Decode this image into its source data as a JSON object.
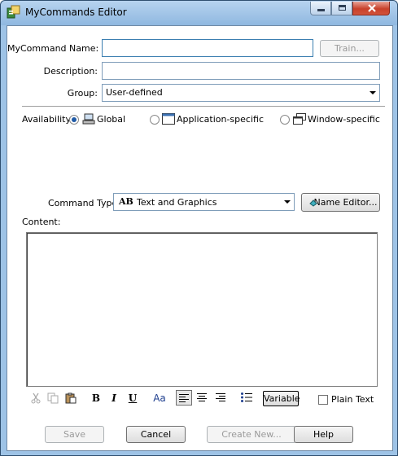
{
  "window": {
    "title": "MyCommands Editor"
  },
  "form": {
    "name_label": "MyCommand Name:",
    "name_value": "",
    "train_button": "Train...",
    "description_label": "Description:",
    "description_value": "",
    "group_label": "Group:",
    "group_value": "User-defined"
  },
  "availability": {
    "label": "Availability:",
    "options": [
      {
        "label": "Global",
        "selected": true,
        "icon": "computer-icon"
      },
      {
        "label": "Application-specific",
        "selected": false,
        "icon": "application-window-icon"
      },
      {
        "label": "Window-specific",
        "selected": false,
        "icon": "windows-stack-icon"
      }
    ]
  },
  "command_type": {
    "label": "Command Type:",
    "value": "Text and Graphics",
    "icon_text": "AB",
    "name_editor_button": "Name Editor..."
  },
  "content": {
    "label": "Content:",
    "toolbar": {
      "bold": "B",
      "italic": "I",
      "underline": "U",
      "font": "Aa",
      "variable_button": "Variable",
      "plain_text_label": "Plain Text",
      "plain_text_checked": false
    }
  },
  "buttons": {
    "save": "Save",
    "cancel": "Cancel",
    "create_new": "Create New...",
    "help": "Help"
  }
}
